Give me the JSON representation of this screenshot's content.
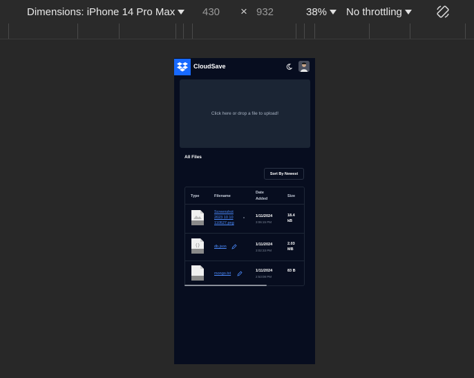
{
  "devtools": {
    "dimensions_label": "Dimensions: iPhone 14 Pro Max",
    "width_value": "430",
    "times_symbol": "×",
    "height_value": "932",
    "zoom": "38%",
    "throttling": "No throttling",
    "rotate_icon": "rotate-icon"
  },
  "app": {
    "title": "CloudSave",
    "brand_color": "#1769ff",
    "upload_text": "Click here or drop a file to upload!",
    "section_title": "All Files",
    "sort_label": "Sort By Newest",
    "columns": {
      "type": "Type",
      "filename": "Filename",
      "date": "Date Added",
      "size": "Size"
    },
    "files": [
      {
        "name": "Screenshot 2023 10 10 110527.png",
        "date": "1/11/2024",
        "time": "3:06:15 PM",
        "size": "18.4 kB",
        "icon": "image-file-icon"
      },
      {
        "name": "db.json",
        "date": "1/11/2024",
        "time": "3:02:33 PM",
        "size": "2.03 MB",
        "icon": "json-file-icon"
      },
      {
        "name": "mongo.txt",
        "date": "1/11/2024",
        "time": "2:53:08 PM",
        "size": "83 B",
        "icon": "text-file-icon"
      }
    ]
  }
}
